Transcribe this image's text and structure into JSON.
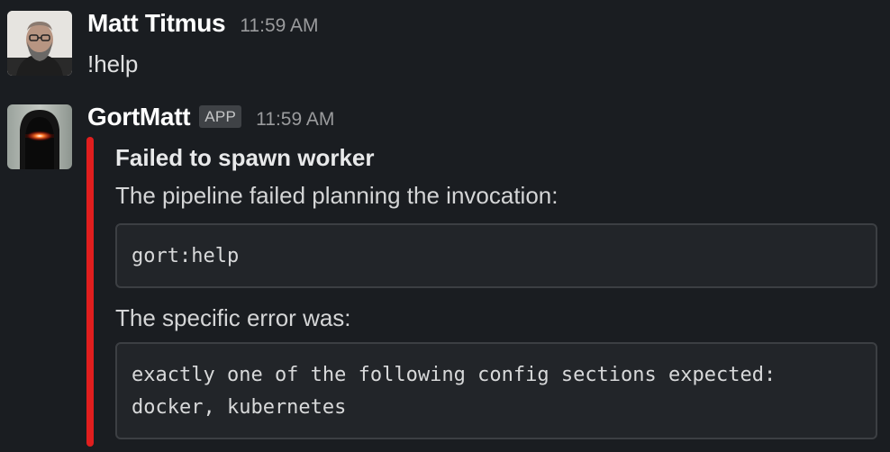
{
  "messages": [
    {
      "user": "Matt Titmus",
      "time": "11:59 AM",
      "text": "!help"
    },
    {
      "user": "GortMatt",
      "badge": "APP",
      "time": "11:59 AM",
      "attachment": {
        "accent_color": "#e01e1e",
        "title": "Failed to spawn worker",
        "intro": "The pipeline failed planning the invocation:",
        "invocation": "gort:help",
        "error_label": "The specific error was:",
        "error_line1": "exactly one of the following config sections expected:",
        "error_line2": "docker, kubernetes"
      }
    }
  ]
}
